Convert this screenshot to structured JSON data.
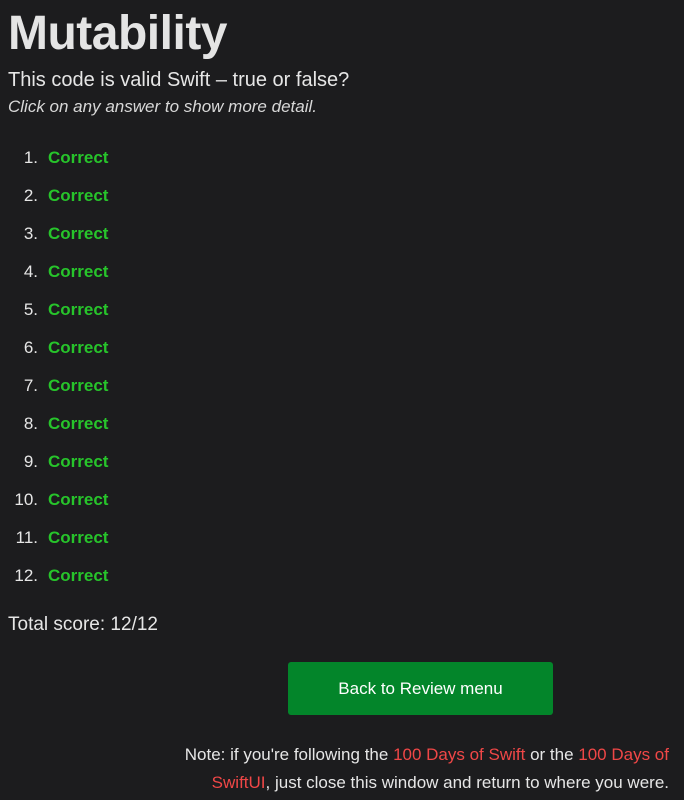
{
  "title": "Mutability",
  "question": "This code is valid Swift – true or false?",
  "hint": "Click on any answer to show more detail.",
  "answers": [
    {
      "number": "1.",
      "result": "Correct"
    },
    {
      "number": "2.",
      "result": "Correct"
    },
    {
      "number": "3.",
      "result": "Correct"
    },
    {
      "number": "4.",
      "result": "Correct"
    },
    {
      "number": "5.",
      "result": "Correct"
    },
    {
      "number": "6.",
      "result": "Correct"
    },
    {
      "number": "7.",
      "result": "Correct"
    },
    {
      "number": "8.",
      "result": "Correct"
    },
    {
      "number": "9.",
      "result": "Correct"
    },
    {
      "number": "10.",
      "result": "Correct"
    },
    {
      "number": "11.",
      "result": "Correct"
    },
    {
      "number": "12.",
      "result": "Correct"
    }
  ],
  "total_score": "Total score: 12/12",
  "back_button": "Back to Review menu",
  "note": {
    "prefix": "Note: if you're following the ",
    "link1": "100 Days of Swift",
    "middle": " or the ",
    "link2": "100 Days of SwiftUI",
    "suffix": ", just close this window and return to where you were."
  },
  "colors": {
    "background": "#1c1c1e",
    "correct": "#27c42b",
    "button": "#03852a",
    "link": "#f04747"
  }
}
